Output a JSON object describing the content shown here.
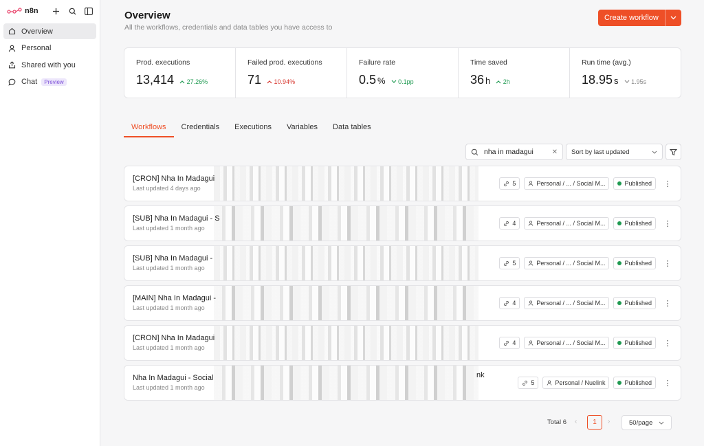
{
  "app": {
    "logo_text": "n8n"
  },
  "sidebar": {
    "items": [
      {
        "label": "Overview",
        "icon": "home-icon",
        "active": true
      },
      {
        "label": "Personal",
        "icon": "user-icon",
        "active": false
      },
      {
        "label": "Shared with you",
        "icon": "share-icon",
        "active": false
      },
      {
        "label": "Chat",
        "icon": "chat-icon",
        "active": false,
        "badge": "Preview"
      }
    ]
  },
  "header": {
    "title": "Overview",
    "subtitle": "All the workflows, credentials and data tables you have access to",
    "create_label": "Create workflow"
  },
  "stats": [
    {
      "label": "Prod. executions",
      "value": "13,414",
      "unit": "",
      "delta": "27.26%",
      "trend": "up"
    },
    {
      "label": "Failed prod. executions",
      "value": "71",
      "unit": "",
      "delta": "10.94%",
      "trend": "up-bad"
    },
    {
      "label": "Failure rate",
      "value": "0.5",
      "unit": "%",
      "delta": "0.1pp",
      "trend": "down-good"
    },
    {
      "label": "Time saved",
      "value": "36",
      "unit": "h",
      "delta": "2h",
      "trend": "up"
    },
    {
      "label": "Run time (avg.)",
      "value": "18.95",
      "unit": "s",
      "delta": "1.95s",
      "trend": "down-neutral"
    }
  ],
  "tabs": [
    "Workflows",
    "Credentials",
    "Executions",
    "Variables",
    "Data tables"
  ],
  "search": {
    "value": "nha in madagui"
  },
  "sort": {
    "label": "Sort by last updated"
  },
  "workflows": [
    {
      "name": "[CRON] Nha In Madagui",
      "updated": "Last updated 4 days ago",
      "links": "5",
      "project": "Personal / ... / Social M...",
      "status": "Published"
    },
    {
      "name": "[SUB] Nha In Madagui - S",
      "updated": "Last updated 1 month ago",
      "links": "4",
      "project": "Personal / ... / Social M...",
      "status": "Published"
    },
    {
      "name": "[SUB] Nha In Madagui -",
      "updated": "Last updated 1 month ago",
      "links": "5",
      "project": "Personal / ... / Social M...",
      "status": "Published"
    },
    {
      "name": "[MAIN] Nha In Madagui -",
      "updated": "Last updated 1 month ago",
      "links": "4",
      "project": "Personal / ... / Social M...",
      "status": "Published"
    },
    {
      "name": "[CRON] Nha In Madagui",
      "updated": "Last updated 1 month ago",
      "links": "4",
      "project": "Personal / ... / Social M...",
      "status": "Published"
    },
    {
      "name": "Nha In Madagui - Social",
      "updated": "Last updated 1 month ago",
      "links": "5",
      "project": "Personal / Nuelink",
      "status": "Published",
      "extra": "nk"
    }
  ],
  "pagination": {
    "total": "Total 6",
    "page": "1",
    "page_size": "50/page"
  },
  "colors": {
    "accent": "#ee4f27",
    "success": "#1f9a51",
    "danger": "#d6342c"
  }
}
